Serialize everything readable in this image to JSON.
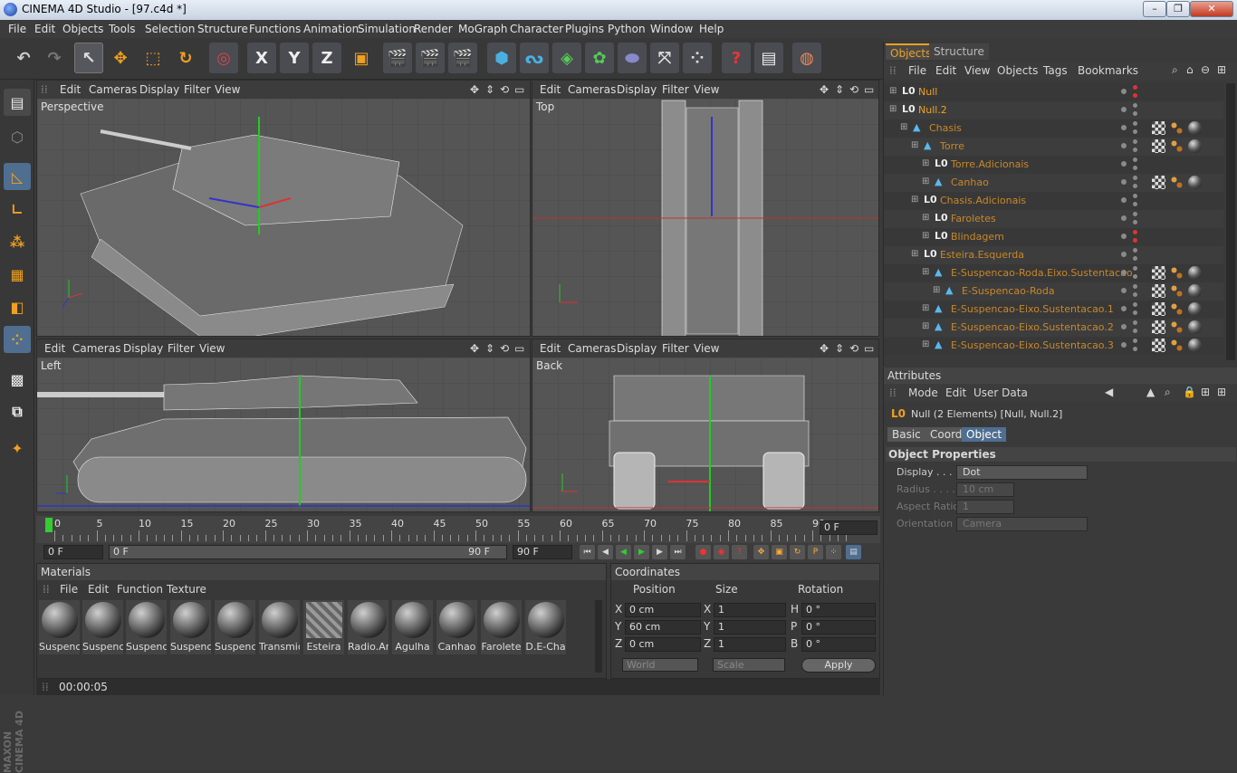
{
  "window": {
    "title": "CINEMA 4D Studio - [97.c4d *]",
    "min": "–",
    "max": "❐",
    "close": "✕"
  },
  "menu": [
    "File",
    "Edit",
    "Objects",
    "Tools",
    "Selection",
    "Structure",
    "Functions",
    "Animation",
    "Simulation",
    "Render",
    "MoGraph",
    "Character",
    "Plugins",
    "Python",
    "Window",
    "Help"
  ],
  "toolbar": {
    "undo": "↶",
    "redo": "↷",
    "select": "↖",
    "move": "✥",
    "scale": "⬚",
    "rotate": "↻",
    "x": "X",
    "y": "Y",
    "z": "Z"
  },
  "viewports": {
    "menu": {
      "edit": "Edit",
      "cameras": "Cameras",
      "display": "Display",
      "filter": "Filter",
      "view": "View"
    },
    "perspective": "Perspective",
    "top": "Top",
    "left": "Left",
    "back": "Back"
  },
  "timeline": {
    "ticks": [
      "0",
      "5",
      "10",
      "15",
      "20",
      "25",
      "30",
      "35",
      "40",
      "45",
      "50",
      "55",
      "60",
      "65",
      "70",
      "75",
      "80",
      "85",
      "90"
    ],
    "current_frame": "0 F",
    "start": "0 F",
    "range_start": "0 F",
    "range_end": "90 F",
    "end": "90 F"
  },
  "materials": {
    "title": "Materials",
    "menu": [
      "File",
      "Edit",
      "Function",
      "Texture"
    ],
    "items": [
      "Suspenc",
      "Suspenc",
      "Suspenc",
      "Suspenc",
      "Suspenc",
      "Transmic",
      "Esteira",
      "Radio.Ar",
      "Agulha",
      "Canhao",
      "Farolete",
      "D.E-Cha"
    ]
  },
  "coordinates": {
    "title": "Coordinates",
    "headers": [
      "Position",
      "Size",
      "Rotation"
    ],
    "rows": [
      {
        "axis": "X",
        "pos": "0 cm",
        "sax": "X",
        "size": "1",
        "rax": "H",
        "rot": "0 °"
      },
      {
        "axis": "Y",
        "pos": "60 cm",
        "sax": "Y",
        "size": "1",
        "rax": "P",
        "rot": "0 °"
      },
      {
        "axis": "Z",
        "pos": "0 cm",
        "sax": "Z",
        "size": "1",
        "rax": "B",
        "rot": "0 °"
      }
    ],
    "mode1": "World",
    "mode2": "Scale",
    "apply": "Apply"
  },
  "status": {
    "time": "00:00:05"
  },
  "objects": {
    "tab_objects": "Objects",
    "tab_structure": "Structure",
    "menu": [
      "File",
      "Edit",
      "View",
      "Objects",
      "Tags",
      "Bookmarks"
    ],
    "rows": [
      {
        "name": "Null",
        "indent": 0,
        "icon": "L0",
        "color": "#f0a020",
        "tags": 0,
        "red": 1
      },
      {
        "name": "Null.2",
        "indent": 0,
        "icon": "L0",
        "color": "#f0a020",
        "tags": 0,
        "red": 0
      },
      {
        "name": "Chasis",
        "indent": 1,
        "icon": "tri",
        "color": "#c8872a",
        "tags": 3,
        "red": 0
      },
      {
        "name": "Torre",
        "indent": 2,
        "icon": "tri",
        "color": "#c8872a",
        "tags": 3,
        "red": 0
      },
      {
        "name": "Torre.Adicionais",
        "indent": 3,
        "icon": "L0",
        "color": "#c8872a",
        "tags": 0,
        "red": 0
      },
      {
        "name": "Canhao",
        "indent": 3,
        "icon": "tri",
        "color": "#c8872a",
        "tags": 3,
        "red": 0
      },
      {
        "name": "Chasis.Adicionais",
        "indent": 2,
        "icon": "L0",
        "color": "#c8872a",
        "tags": 0,
        "red": 0
      },
      {
        "name": "Faroletes",
        "indent": 3,
        "icon": "L0",
        "color": "#c8872a",
        "tags": 0,
        "red": 0
      },
      {
        "name": "Blindagem",
        "indent": 3,
        "icon": "L0",
        "color": "#c8872a",
        "tags": 0,
        "red": 1
      },
      {
        "name": "Esteira.Esquerda",
        "indent": 2,
        "icon": "L0",
        "color": "#c8872a",
        "tags": 0,
        "red": 0
      },
      {
        "name": "E-Suspencao-Roda.Eixo.Sustentacao",
        "indent": 3,
        "icon": "tri",
        "color": "#c8872a",
        "tags": 3,
        "red": 0
      },
      {
        "name": "E-Suspencao-Roda",
        "indent": 4,
        "icon": "tri",
        "color": "#c8872a",
        "tags": 3,
        "red": 0
      },
      {
        "name": "E-Suspencao-Eixo.Sustentacao.1",
        "indent": 3,
        "icon": "tri",
        "color": "#c8872a",
        "tags": 3,
        "red": 0
      },
      {
        "name": "E-Suspencao-Eixo.Sustentacao.2",
        "indent": 3,
        "icon": "tri",
        "color": "#c8872a",
        "tags": 3,
        "red": 0
      },
      {
        "name": "E-Suspencao-Eixo.Sustentacao.3",
        "indent": 3,
        "icon": "tri",
        "color": "#c8872a",
        "tags": 3,
        "red": 0
      }
    ]
  },
  "attributes": {
    "title": "Attributes",
    "menu": [
      "Mode",
      "Edit",
      "User Data"
    ],
    "selection": "Null (2 Elements) [Null, Null.2]",
    "tabs": [
      "Basic",
      "Coord",
      "Object"
    ],
    "section": "Object Properties",
    "props": [
      {
        "label": "Display . . . .",
        "value": "Dot",
        "enabled": true
      },
      {
        "label": "Radius . . . .",
        "value": "10 cm",
        "enabled": false
      },
      {
        "label": "Aspect Ratio",
        "value": "1",
        "enabled": false
      },
      {
        "label": "Orientation",
        "value": "Camera",
        "enabled": false
      }
    ]
  },
  "brand": "MAXON CINEMA 4D"
}
